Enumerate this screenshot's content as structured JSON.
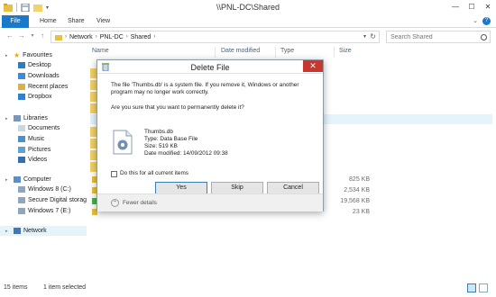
{
  "window": {
    "title": "\\\\PNL-DC\\Shared",
    "min": "—",
    "max": "☐",
    "close": "✕"
  },
  "ribbon": {
    "tabs": [
      "File",
      "Home",
      "Share",
      "View"
    ],
    "help": "?",
    "caret": "⌄"
  },
  "address": {
    "crumbs": [
      "Network",
      "PNL-DC",
      "Shared"
    ],
    "search_placeholder": "Search Shared"
  },
  "nav": {
    "favourites": "Favourites",
    "fav_items": [
      "Desktop",
      "Downloads",
      "Recent places",
      "Dropbox"
    ],
    "libraries": "Libraries",
    "lib_items": [
      "Documents",
      "Music",
      "Pictures",
      "Videos"
    ],
    "computer": "Computer",
    "comp_items": [
      "Windows 8 (C:)",
      "Secure Digital storag",
      "Windows 7 (E:)"
    ],
    "network": "Network"
  },
  "list": {
    "columns": [
      "Name",
      "Date modified",
      "Type",
      "Size"
    ],
    "rows": [
      {
        "name": "",
        "size": "825 KB"
      },
      {
        "name": "",
        "size": "2,534 KB"
      },
      {
        "name": "",
        "size": "19,568 KB"
      },
      {
        "name": "",
        "size": "23 KB"
      }
    ]
  },
  "status": {
    "count": "15 items",
    "selected": "1 item selected"
  },
  "dialog": {
    "title": "Delete File",
    "line1": "The file 'Thumbs.db' is a system file. If you remove it, Windows or another",
    "line2": "program may no longer work correctly.",
    "question": "Are you sure that you want to permanently delete it?",
    "file": {
      "name": "Thumbs.db",
      "type": "Type: Data Base File",
      "size": "Size: 519 KB",
      "date": "Date modified: 14/09/2012 09:38"
    },
    "checkbox_label": "Do this for all current items",
    "yes": "Yes",
    "skip": "Skip",
    "cancel": "Cancel",
    "fewer_details": "Fewer details"
  }
}
